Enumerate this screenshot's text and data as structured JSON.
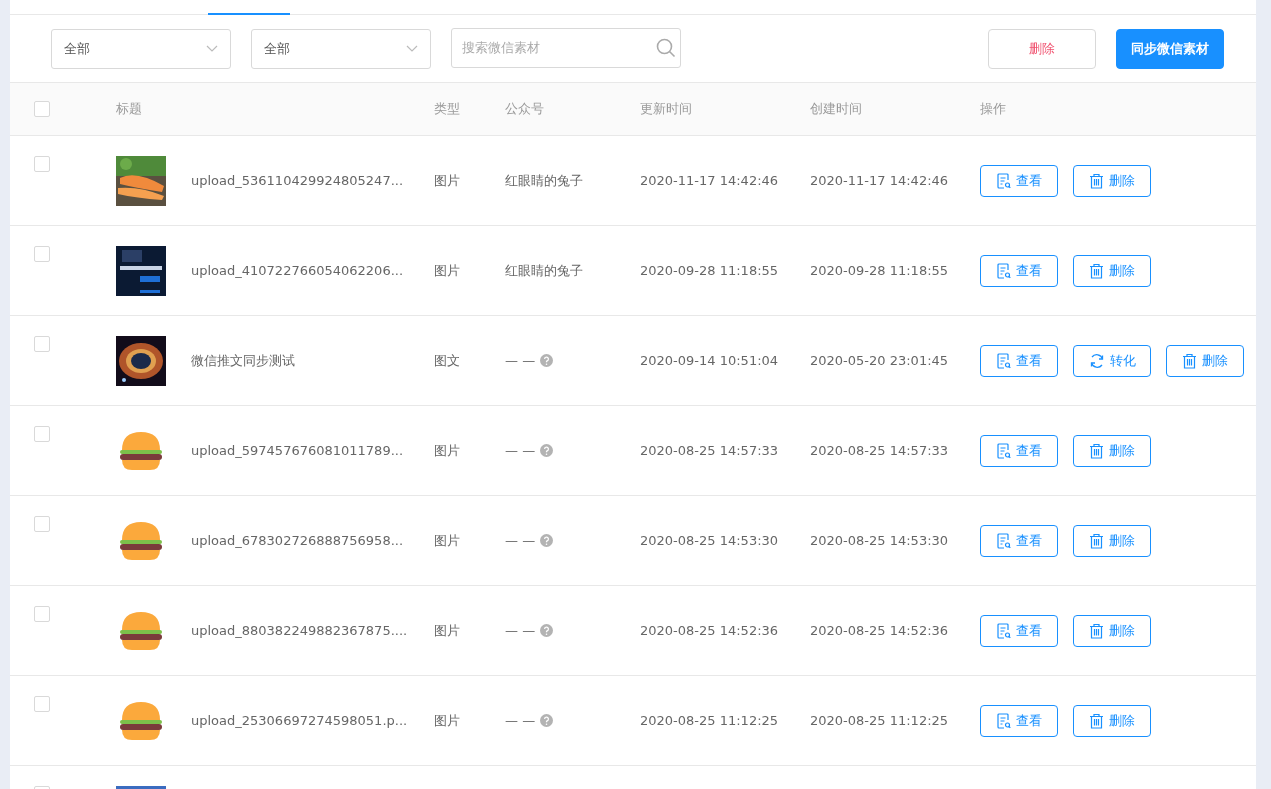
{
  "filters": [
    {
      "value": "全部"
    },
    {
      "value": "全部"
    }
  ],
  "search": {
    "placeholder": "搜索微信素材"
  },
  "toolbar_buttons": [
    {
      "label": "删除",
      "kind": "danger"
    },
    {
      "label": "同步微信素材",
      "kind": "primary"
    }
  ],
  "table": {
    "select_all": {
      "checked": false
    },
    "columns": [
      "标题",
      "类型",
      "公众号",
      "更新时间",
      "创建时间",
      "操作"
    ],
    "rows": [
      {
        "checked": false,
        "thumbnail": {
          "kind": "picture"
        },
        "title": "upload_536110429924805247...",
        "type": "图片",
        "account": "红眼睛的兔子",
        "account_help": false,
        "updated": "2020-11-17 14:42:46",
        "created": "2020-11-17 14:42:46",
        "actions": [
          {
            "label": "查看",
            "kind": "view"
          },
          {
            "label": "删除",
            "kind": "delete"
          }
        ]
      },
      {
        "checked": false,
        "thumbnail": {
          "kind": "picture"
        },
        "title": "upload_410722766054062206...",
        "type": "图片",
        "account": "红眼睛的兔子",
        "account_help": false,
        "updated": "2020-09-28 11:18:55",
        "created": "2020-09-28 11:18:55",
        "actions": [
          {
            "label": "查看",
            "kind": "view"
          },
          {
            "label": "删除",
            "kind": "delete"
          }
        ]
      },
      {
        "checked": false,
        "thumbnail": {
          "kind": "picture"
        },
        "title": "微信推文同步测试",
        "type": "图文",
        "account": "— —",
        "account_help": true,
        "updated": "2020-09-14 10:51:04",
        "created": "2020-05-20 23:01:45",
        "actions": [
          {
            "label": "查看",
            "kind": "view"
          },
          {
            "label": "转化",
            "kind": "convert"
          },
          {
            "label": "删除",
            "kind": "delete"
          }
        ]
      },
      {
        "checked": false,
        "thumbnail": {
          "kind": "picture"
        },
        "title": "upload_597457676081011789...",
        "type": "图片",
        "account": "— —",
        "account_help": true,
        "updated": "2020-08-25 14:57:33",
        "created": "2020-08-25 14:57:33",
        "actions": [
          {
            "label": "查看",
            "kind": "view"
          },
          {
            "label": "删除",
            "kind": "delete"
          }
        ]
      },
      {
        "checked": false,
        "thumbnail": {
          "kind": "picture"
        },
        "title": "upload_678302726888756958...",
        "type": "图片",
        "account": "— —",
        "account_help": true,
        "updated": "2020-08-25 14:53:30",
        "created": "2020-08-25 14:53:30",
        "actions": [
          {
            "label": "查看",
            "kind": "view"
          },
          {
            "label": "删除",
            "kind": "delete"
          }
        ]
      },
      {
        "checked": false,
        "thumbnail": {
          "kind": "picture"
        },
        "title": "upload_880382249882367875....",
        "type": "图片",
        "account": "— —",
        "account_help": true,
        "updated": "2020-08-25 14:52:36",
        "created": "2020-08-25 14:52:36",
        "actions": [
          {
            "label": "查看",
            "kind": "view"
          },
          {
            "label": "删除",
            "kind": "delete"
          }
        ]
      },
      {
        "checked": false,
        "thumbnail": {
          "kind": "picture"
        },
        "title": "upload_25306697274598051.p...",
        "type": "图片",
        "account": "— —",
        "account_help": true,
        "updated": "2020-08-25 11:12:25",
        "created": "2020-08-25 11:12:25",
        "actions": [
          {
            "label": "查看",
            "kind": "view"
          },
          {
            "label": "删除",
            "kind": "delete"
          }
        ]
      },
      {
        "checked": false,
        "thumbnail": {
          "kind": "picture"
        }
      }
    ]
  }
}
